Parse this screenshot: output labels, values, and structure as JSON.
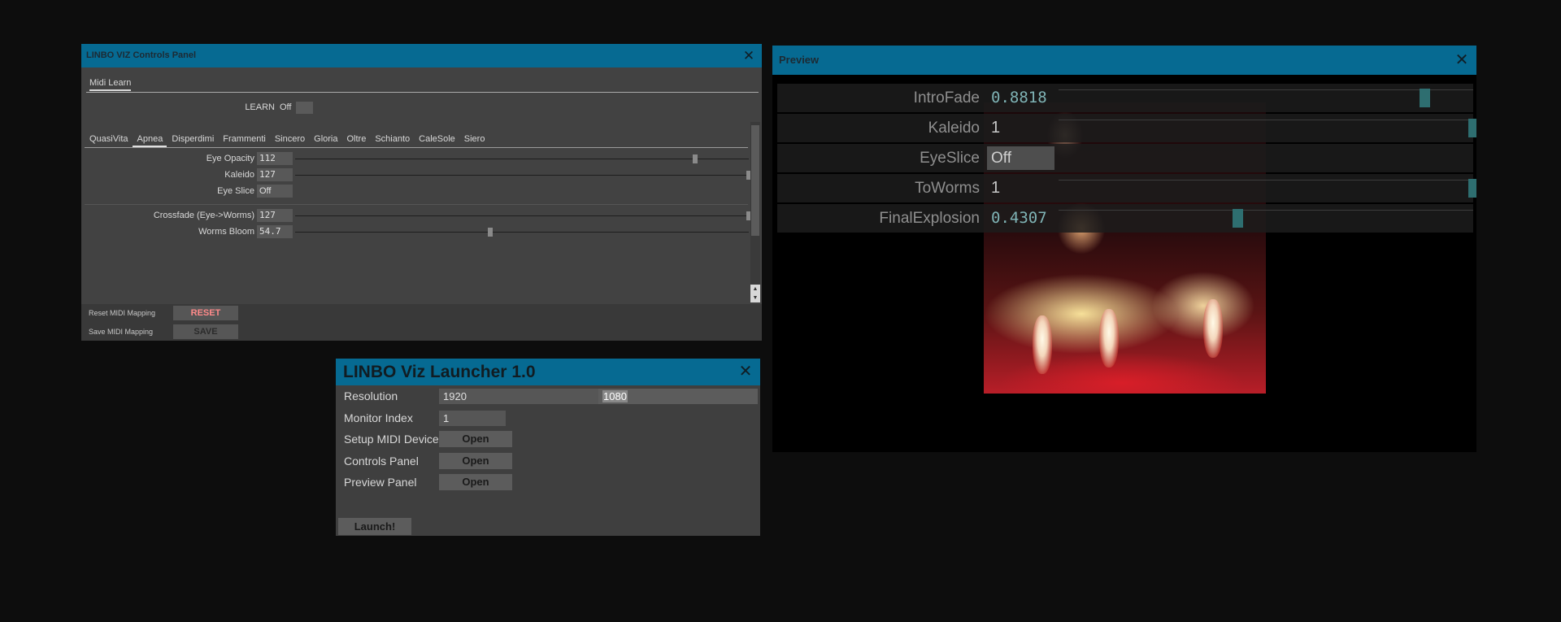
{
  "controls_panel": {
    "title": "LINBO VIZ Controls Panel",
    "close_glyph": "✕",
    "subtab": "Midi Learn",
    "learn": {
      "label": "LEARN",
      "value": "Off"
    },
    "tabs": [
      "QuasiVita",
      "Apnea",
      "Disperdimi",
      "Frammenti",
      "Sincero",
      "Gloria",
      "Oltre",
      "Schianto",
      "CaleSole",
      "Siero"
    ],
    "active_tab": "Apnea",
    "params": [
      {
        "label": "Eye Opacity",
        "value": "112",
        "fraction": 0.882
      },
      {
        "label": "Kaleido",
        "value": "127",
        "fraction": 1.0
      },
      {
        "label": "Eye Slice",
        "value": "Off"
      },
      {
        "label": "Crossfade (Eye->Worms)",
        "value": "127",
        "fraction": 1.0
      },
      {
        "label": "Worms Bloom",
        "value": "54.7",
        "fraction": 0.431
      }
    ],
    "footer": {
      "reset_label": "Reset MIDI Mapping",
      "reset_button": "RESET",
      "reset_color": "#ff8a8a",
      "save_label": "Save MIDI Mapping",
      "save_button": "SAVE",
      "save_color": "#2b2b2b"
    },
    "scroll_up": "▲",
    "scroll_down": "▼"
  },
  "preview_panel": {
    "title": "Preview",
    "close_glyph": "✕",
    "params": [
      {
        "label": "IntroFade",
        "value": "0.8818",
        "fraction": 0.8818
      },
      {
        "label": "Kaleido",
        "value": "1",
        "fraction": 1.0
      },
      {
        "label": "EyeSlice",
        "value": "Off"
      },
      {
        "label": "ToWorms",
        "value": "1",
        "fraction": 1.0
      },
      {
        "label": "FinalExplosion",
        "value": "0.4307",
        "fraction": 0.4307
      }
    ]
  },
  "launcher": {
    "title": "LINBO Viz Launcher 1.0",
    "close_glyph": "✕",
    "resolution": {
      "label": "Resolution",
      "width": "1920",
      "height": "1080"
    },
    "monitor": {
      "label": "Monitor Index",
      "value": "1"
    },
    "midi": {
      "label": "Setup MIDI Device",
      "button": "Open"
    },
    "controls": {
      "label": "Controls Panel",
      "button": "Open"
    },
    "preview": {
      "label": "Preview Panel",
      "button": "Open"
    },
    "launch_button": "Launch!"
  }
}
